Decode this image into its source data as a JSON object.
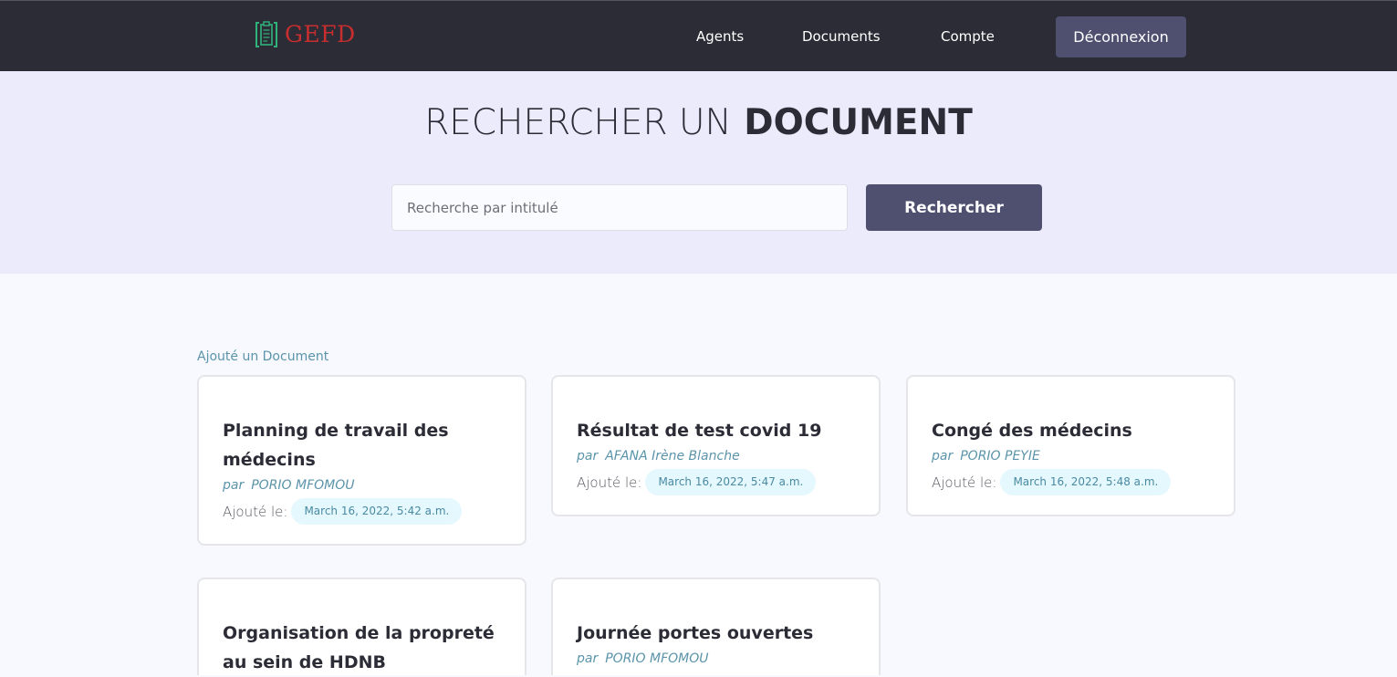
{
  "nav": {
    "brand": "GEFD",
    "links": [
      "Agents",
      "Documents",
      "Compte"
    ],
    "logout": "Déconnexion"
  },
  "hero": {
    "title_light": "RECHERCHER UN",
    "title_bold": "DOCUMENT",
    "search_placeholder": "Recherche par intitulé",
    "search_button": "Rechercher"
  },
  "content": {
    "add_link": "Ajouté un Document",
    "by_label": "par",
    "date_label": "Ajouté le:",
    "documents": [
      {
        "title": "Planning de travail des médecins",
        "author": "PORIO MFOMOU",
        "date": "March 16, 2022, 5:42 a.m."
      },
      {
        "title": "Résultat de test covid 19",
        "author": "AFANA Irène Blanche",
        "date": "March 16, 2022, 5:47 a.m."
      },
      {
        "title": "Congé des médecins",
        "author": "PORIO PEYIE",
        "date": "March 16, 2022, 5:48 a.m."
      },
      {
        "title": "Organisation de la propreté au sein de HDNB",
        "author": "",
        "date": ""
      },
      {
        "title": "Journée portes ouvertes",
        "author": "PORIO MFOMOU",
        "date": ""
      }
    ]
  },
  "colors": {
    "navbar_bg": "#2c2c36",
    "accent_button": "#4f5070",
    "hero_bg": "#ecebfc",
    "link_teal": "#5b94aa",
    "brand_red": "#c92e2e",
    "badge_bg": "#e4f8fd"
  }
}
